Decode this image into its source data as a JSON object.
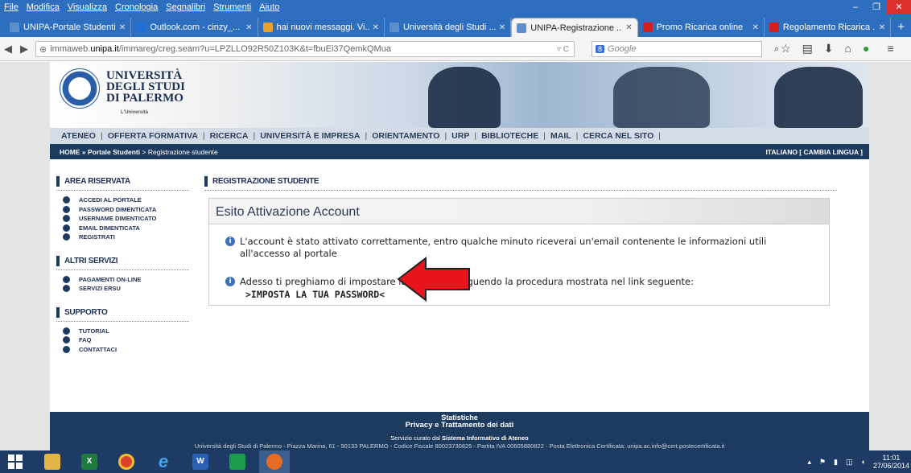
{
  "menubar": {
    "items": [
      "File",
      "Modifica",
      "Visualizza",
      "Cronologia",
      "Segnalibri",
      "Strumenti",
      "Aiuto"
    ]
  },
  "window": {
    "min": "–",
    "max": "❐",
    "close": "✕"
  },
  "tabs": [
    {
      "label": "UNIPA-Portale Studenti",
      "icon_color": "#5d8fcc",
      "active": false
    },
    {
      "label": "Outlook.com - cinzy_...",
      "icon_color": "#1d6fd1",
      "active": false
    },
    {
      "label": "hai nuovi messaggi. Vi...",
      "icon_color": "#e6a02b",
      "active": false
    },
    {
      "label": "Università degli Studi ...",
      "icon_color": "#5d8fcc",
      "active": false
    },
    {
      "label": "UNIPA-Registrazione ...",
      "icon_color": "#5d8fcc",
      "active": true
    },
    {
      "label": "Promo Ricarica online",
      "icon_color": "#d21f1f",
      "active": false
    },
    {
      "label": "Regolamento Ricarica ...",
      "icon_color": "#d21f1f",
      "active": false
    }
  ],
  "newtab": "+",
  "url": {
    "prefix": "immaweb.",
    "domain": "unipa.it",
    "rest": "/immareg/creg.seam?u=LPZLLO92R50Z103K&t=fbuEi37QemkQMua",
    "right": "▿ C"
  },
  "search": {
    "engine": "8",
    "placeholder": "Google"
  },
  "site": {
    "title_lines": [
      "UNIVERSITÀ",
      "DEGLI STUDI",
      "DI PALERMO"
    ],
    "tagline": "L'Università",
    "topnav": [
      "ATENEO",
      "OFFERTA FORMATIVA",
      "RICERCA",
      "UNIVERSITÀ E IMPRESA",
      "ORIENTAMENTO",
      "URP",
      "BIBLIOTECHE",
      "MAIL",
      "CERCA NEL SITO"
    ],
    "crumb": {
      "home": "HOME",
      "sep": " » ",
      "portal": "Portale Studenti",
      "page": " > Registrazione studente",
      "lang": "ITALIANO [ CAMBIA LINGUA ]"
    },
    "left": {
      "area": "AREA RISERVATA",
      "area_items": [
        "ACCEDI AL PORTALE",
        "PASSWORD DIMENTICATA",
        "USERNAME DIMENTICATO",
        "EMAIL DIMENTICATA",
        "REGISTRATI"
      ],
      "altri": "ALTRI SERVIZI",
      "altri_items": [
        "PAGAMENTI ON-LINE",
        "SERVIZI ERSU"
      ],
      "supporto": "SUPPORTO",
      "supporto_items": [
        "TUTORIAL",
        "FAQ",
        "CONTATTACI"
      ]
    },
    "main": {
      "section": "REGISTRAZIONE STUDENTE",
      "box_title": "Esito Attivazione Account",
      "msg1": "L'account è stato attivato correttamente, entro qualche minuto riceverai un'email contenente le informazioni utili all'accesso al portale",
      "msg2": "Adesso ti preghiamo di impostare la password seguendo la procedura mostrata nel link seguente:",
      "link": ">IMPOSTA LA TUA PASSWORD<"
    },
    "footer": {
      "stat": "Statistiche",
      "privacy": "Privacy e Trattamento dei dati",
      "service_pre": "Servizio curato dal ",
      "service_bold": "Sistema Informativo di Ateneo",
      "address": "Università degli Studi di Palermo - Piazza Marina, 61 - 90133 PALERMO - Codice Fiscale 80023730825 - Partita IVA 00605880822 - Posta Elettronica Certificata: unipa.ac.info@cert.postecertificata.it"
    }
  },
  "taskbar": {
    "time": "11:01",
    "date": "27/06/2014"
  }
}
